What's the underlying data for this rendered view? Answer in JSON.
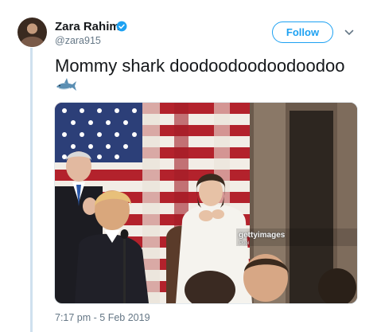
{
  "user": {
    "display_name": "Zara Rahim",
    "handle": "@zara915",
    "verified": true
  },
  "follow_button": {
    "label": "Follow"
  },
  "tweet": {
    "text": "Mommy shark doodoodoodoodoodoo",
    "emoji": "shark-emoji"
  },
  "media": {
    "watermark": "gettyimages",
    "watermark_sub": "Pool"
  },
  "timestamp": "7:17 pm - 5 Feb 2019",
  "colors": {
    "accent": "#1da1f2",
    "text": "#14171a",
    "muted": "#657786"
  }
}
